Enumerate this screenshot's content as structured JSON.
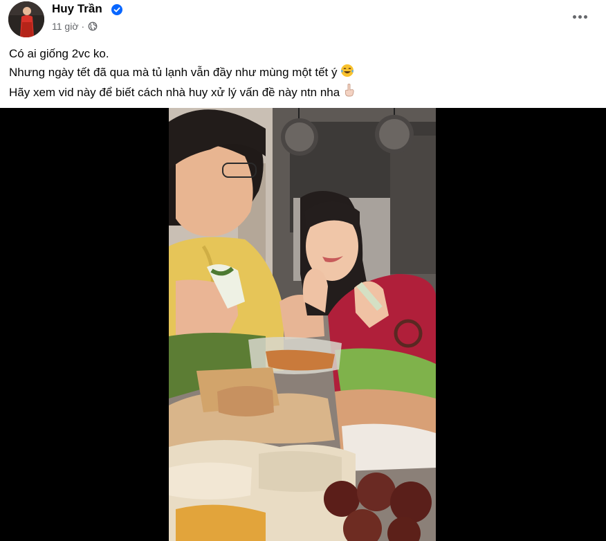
{
  "author": {
    "name": "Huy Trần",
    "verified": true
  },
  "meta": {
    "time": "11 giờ",
    "separator": "·",
    "audience_icon": "globe-icon"
  },
  "post": {
    "lines": [
      "Có ai giống 2vc ko.",
      "Nhưng ngày tết đã qua mà tủ lạnh vẫn đầy như mùng một tết ý",
      "Hãy xem vid này để biết cách nhà huy xử lý vấn đề này ntn nha"
    ],
    "emojis": [
      "laughing-crying-emoji",
      "pointing-down-emoji"
    ]
  },
  "media": {
    "type": "video"
  },
  "colors": {
    "secondary_text": "#65676b",
    "verified_blue": "#0866ff",
    "media_bg": "#000000"
  }
}
